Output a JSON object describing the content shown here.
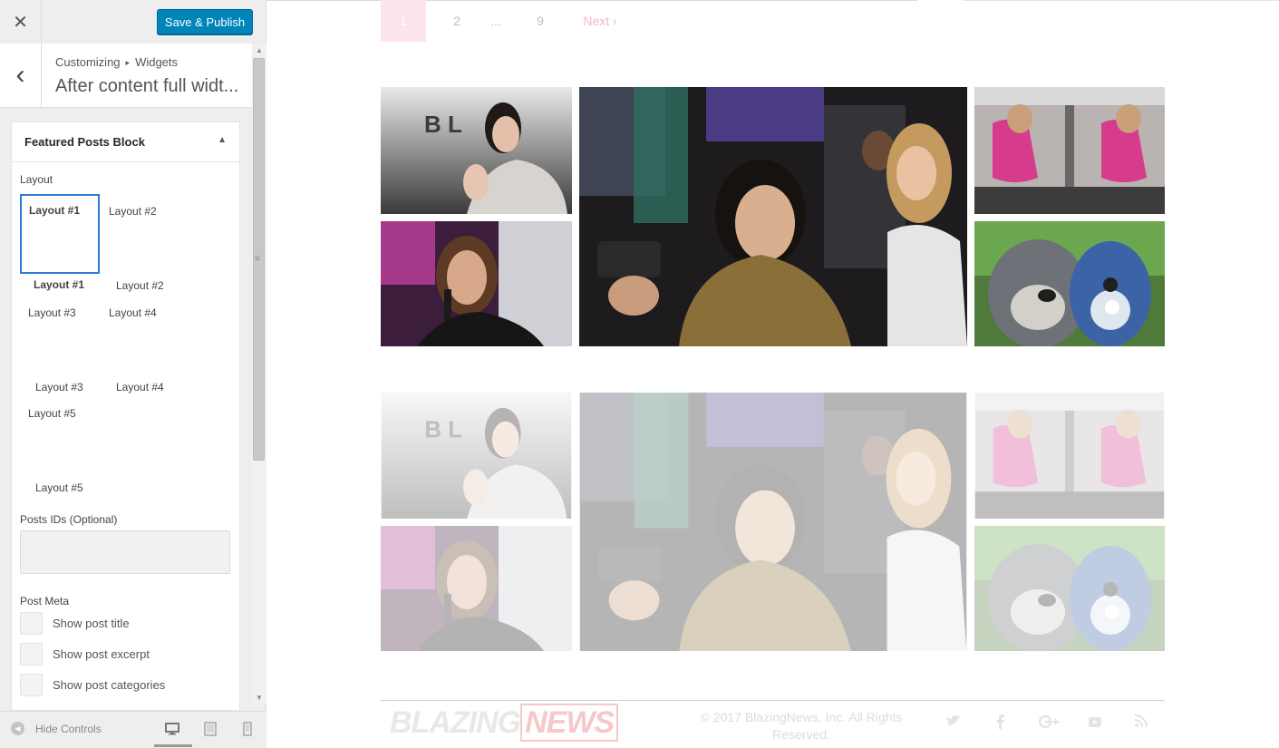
{
  "customizer": {
    "close_symbol": "✕",
    "save_label": "Save & Publish",
    "back_symbol": "‹",
    "breadcrumb": {
      "parent": "Customizing",
      "separator": "▸",
      "current": "Widgets"
    },
    "section_title": "After content full widt...",
    "widget": {
      "title": "Featured Posts Block",
      "toggle_symbol": "▲",
      "layout_label": "Layout",
      "layout_options": [
        "Layout #1",
        "Layout #2",
        "Layout #1",
        "Layout #2",
        "Layout #3",
        "Layout #4",
        "Layout #3",
        "Layout #4",
        "Layout #5",
        "Layout #5"
      ],
      "selected_layout": "Layout #1",
      "post_ids_label": "Posts IDs (Optional)",
      "post_ids_value": "",
      "post_meta_label": "Post Meta",
      "checkboxes": [
        {
          "label": "Show post title",
          "checked": false
        },
        {
          "label": "Show post excerpt",
          "checked": false
        },
        {
          "label": "Show post categories",
          "checked": false
        }
      ]
    },
    "footer": {
      "hide_controls": "Hide Controls",
      "devices": [
        "desktop-icon",
        "tablet-icon",
        "mobile-icon"
      ],
      "active_device": "desktop"
    }
  },
  "preview": {
    "pagination": {
      "current": "1",
      "pages": [
        "2",
        "...",
        "9"
      ],
      "next": "Next ›"
    },
    "footer": {
      "logo_part1": "BLAZING",
      "logo_part2": "NEWS",
      "copyright": "© 2017 BlazingNews, Inc. All Rights Reserved.",
      "social": [
        "twitter-icon",
        "facebook-icon",
        "google-plus-icon",
        "youtube-icon",
        "rss-icon"
      ]
    }
  },
  "colors": {
    "accent": "#0085ba",
    "selected_border": "#2e7bd6",
    "pagination_current": "#fce3ec",
    "pagination_next": "#f7b6cb"
  }
}
